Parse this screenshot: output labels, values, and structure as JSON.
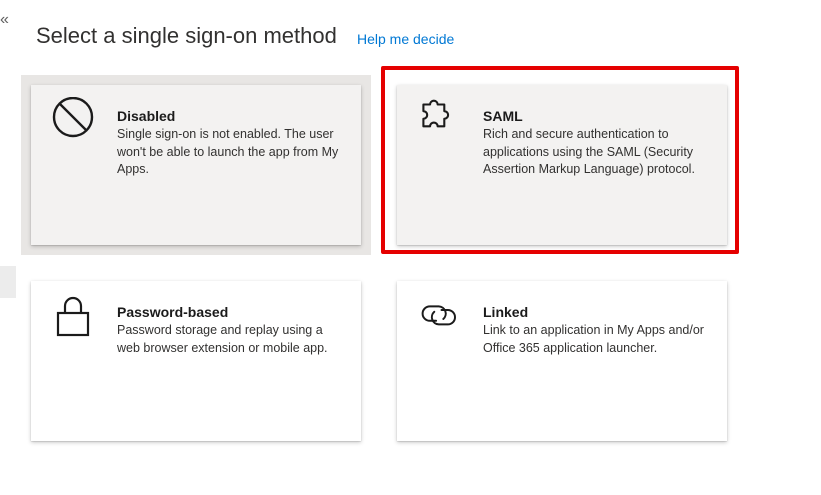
{
  "header": {
    "title": "Select a single sign-on method",
    "help_link": "Help me decide",
    "collapse_glyph": "«"
  },
  "methods": [
    {
      "name": "Disabled",
      "description": "Single sign-on is not enabled. The user won't be able to launch the app from My Apps.",
      "icon": "prohibited-icon",
      "state": "current"
    },
    {
      "name": "SAML",
      "description": "Rich and secure authentication to applications using the SAML (Security Assertion Markup Language) protocol.",
      "icon": "puzzle-piece-icon",
      "state": "highlighted"
    },
    {
      "name": "Password-based",
      "description": "Password storage and replay using a web browser extension or mobile app.",
      "icon": "lock-icon",
      "state": "default"
    },
    {
      "name": "Linked",
      "description": "Link to an application in My Apps and/or Office 365 application launcher.",
      "icon": "link-icon",
      "state": "default"
    }
  ],
  "colors": {
    "accent_link": "#0078d4",
    "highlight_border": "#e50000",
    "selected_tile_bg": "#f3f2f1"
  }
}
